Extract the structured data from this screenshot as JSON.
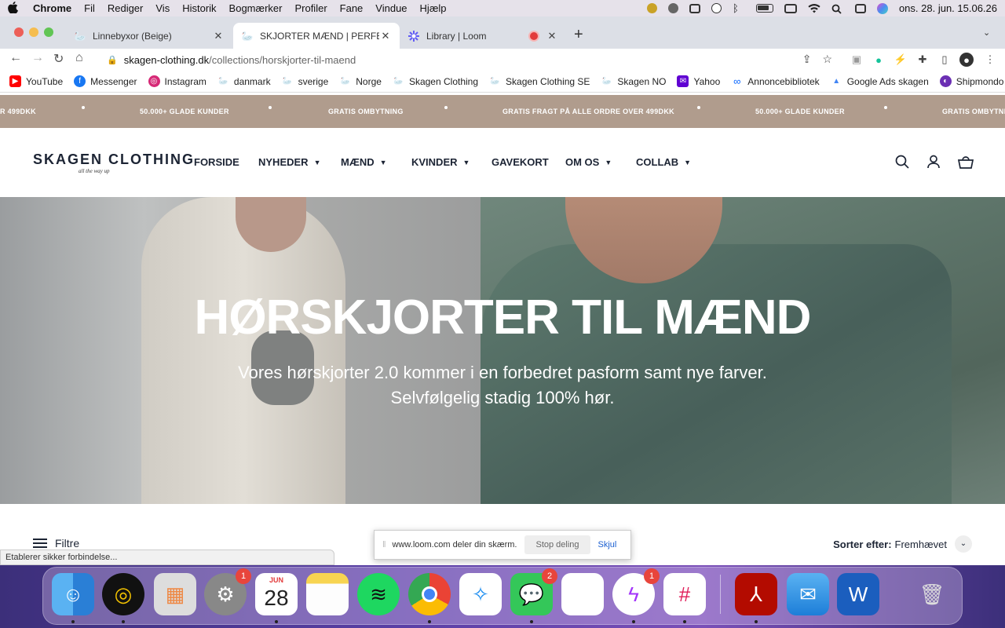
{
  "menubar": {
    "apple": "",
    "items": [
      "Chrome",
      "Fil",
      "Rediger",
      "Vis",
      "Historik",
      "Bogmærker",
      "Profiler",
      "Fane",
      "Vindue",
      "Hjælp"
    ],
    "clock": "ons. 28. jun.  15.06.26"
  },
  "tabs": [
    {
      "title": "Linnebyxor (Beige)",
      "icon": "skagen-swan-icon"
    },
    {
      "title": "SKJORTER MÆND | PERFEKT F",
      "icon": "skagen-swan-icon"
    },
    {
      "title": "Library | Loom",
      "icon": "loom-icon"
    }
  ],
  "toolbar": {
    "url_host": "skagen-clothing.dk",
    "url_path": "/collections/horskjorter-til-maend"
  },
  "bookmarks": [
    {
      "label": "YouTube",
      "color": "#ff0000"
    },
    {
      "label": "Messenger",
      "color": "#1877f2"
    },
    {
      "label": "Instagram",
      "color": "#d62976"
    },
    {
      "label": "danmark",
      "color": "#222222"
    },
    {
      "label": "sverige",
      "color": "#222222"
    },
    {
      "label": "Norge",
      "color": "#222222"
    },
    {
      "label": "Skagen Clothing",
      "color": "#555555"
    },
    {
      "label": "Skagen Clothing SE",
      "color": "#555555"
    },
    {
      "label": "Skagen NO",
      "color": "#555555"
    },
    {
      "label": "Yahoo",
      "color": "#6001d2"
    },
    {
      "label": "Annoncebibliotek",
      "color": "#0866ff"
    },
    {
      "label": "Google Ads skagen",
      "color": "#fbbc04"
    },
    {
      "label": "Shipmondo",
      "color": "#6b2fb3"
    }
  ],
  "announcement": {
    "items": [
      "R 499DKK",
      "50.000+ GLADE KUNDER",
      "GRATIS OMBYTNING",
      "GRATIS FRAGT PÅ ALLE ORDRE OVER 499DKK",
      "50.000+ GLADE KUNDER",
      "GRATIS OMBYTNING"
    ],
    "background": "#b09c8d"
  },
  "site": {
    "logo": "SKAGEN CLOTHING",
    "logo_tagline": "all the way up",
    "nav": [
      {
        "label": "FORSIDE",
        "dropdown": false
      },
      {
        "label": "NYHEDER",
        "dropdown": true
      },
      {
        "label": "MÆND",
        "dropdown": true
      },
      {
        "label": "KVINDER",
        "dropdown": true
      },
      {
        "label": "GAVEKORT",
        "dropdown": false
      },
      {
        "label": "OM OS",
        "dropdown": true
      },
      {
        "label": "COLLAB",
        "dropdown": true
      }
    ]
  },
  "hero": {
    "title": "HØRSKJORTER TIL MÆND",
    "subtitle_line1": "Vores hørskjorter 2.0 kommer i en forbedret pasform samt nye farver.",
    "subtitle_line2": "Selvfølgelig stadig 100% hør."
  },
  "collection": {
    "filter_label": "Filtre",
    "sort_label": "Sorter efter:",
    "sort_value": "Fremhævet"
  },
  "status": "Etablerer sikker forbindelse...",
  "loom_banner": {
    "message": "www.loom.com deler din skærm.",
    "stop": "Stop deling",
    "hide": "Skjul"
  },
  "dock": {
    "calendar_month": "JUN",
    "calendar_day": "28",
    "badges": {
      "settings": "1",
      "messages": "2",
      "messenger": "1"
    }
  }
}
